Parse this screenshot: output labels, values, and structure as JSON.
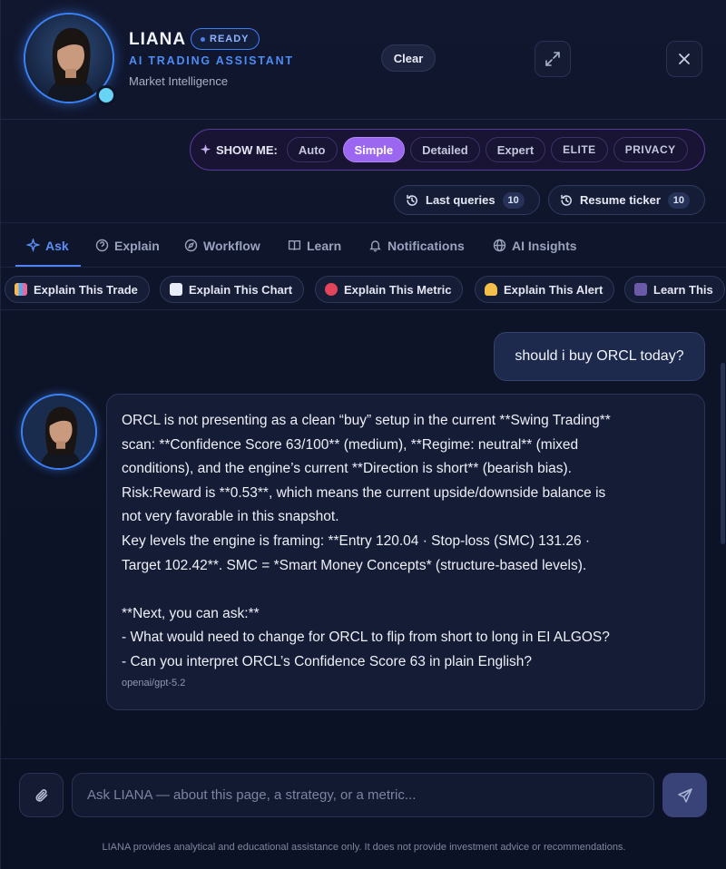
{
  "header": {
    "name": "LIANA",
    "status": "READY",
    "subtitle": "AI TRADING ASSISTANT",
    "tagline": "Market Intelligence",
    "clear_label": "Clear"
  },
  "show_me": {
    "label": "SHOW ME:",
    "modes": [
      "Auto",
      "Simple",
      "Detailed",
      "Expert",
      "ELITE",
      "PRIVACY"
    ],
    "selected": "Simple"
  },
  "history": {
    "last_queries_label": "Last queries",
    "last_queries_count": "10",
    "resume_ticker_label": "Resume ticker",
    "resume_ticker_count": "10"
  },
  "tabs": [
    "Ask",
    "Explain",
    "Workflow",
    "Learn",
    "Notifications",
    "AI Insights"
  ],
  "active_tab": "Ask",
  "quick_actions": [
    "Explain This Trade",
    "Explain This Chart",
    "Explain This Metric",
    "Explain This Alert",
    "Learn This"
  ],
  "chat": {
    "user_message": "should i buy ORCL today?",
    "assistant_lines": [
      "ORCL is not presenting as a clean “buy” setup in the current **Swing Trading**",
      "scan: **Confidence Score 63/100** (medium), **Regime: neutral** (mixed",
      "conditions), and the engine’s current **Direction is short** (bearish bias).",
      "Risk:Reward is **0.53**, which means the current upside/downside balance is",
      "not very favorable in this snapshot.",
      "Key levels the engine is framing: **Entry 120.04 · Stop-loss (SMC) 131.26 ·",
      "Target 102.42**. SMC = *Smart Money Concepts* (structure-based levels).",
      "",
      "**Next, you can ask:**",
      "- What would need to change for ORCL to flip from short to long in EI ALGOS?",
      "- Can you interpret ORCL’s Confidence Score 63 in plain English?"
    ],
    "model": "openai/gpt-5.2"
  },
  "composer": {
    "placeholder": "Ask LIANA — about this page, a strategy, or a metric...",
    "value": ""
  },
  "disclaimer": "LIANA provides analytical and educational assistance only. It does not provide investment advice or recommendations.",
  "colors": {
    "accent_blue": "#4f84f4",
    "accent_purple": "#9b66f0",
    "status_online": "#67d3f5",
    "background": "#0e1428"
  },
  "icons": [
    "expand-icon",
    "close-icon",
    "sparkle-icon",
    "history-icon",
    "paperclip-icon",
    "send-icon"
  ]
}
